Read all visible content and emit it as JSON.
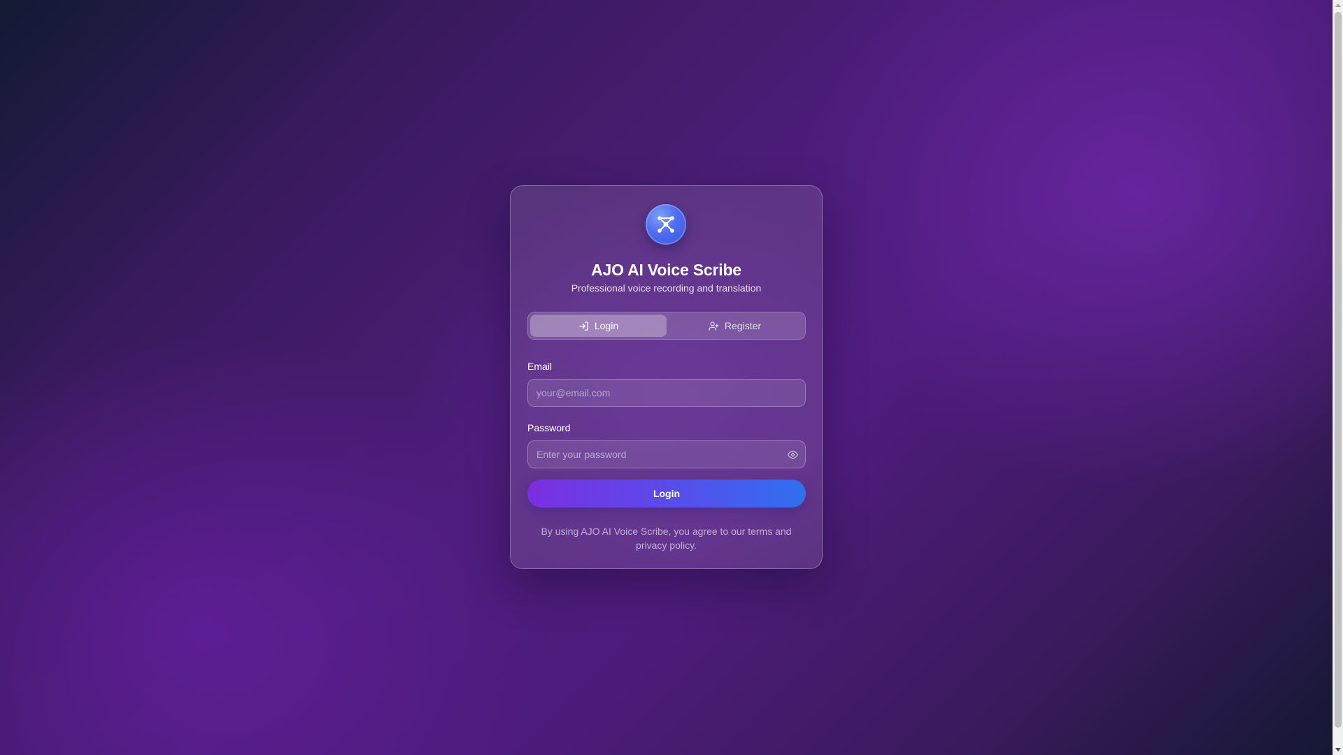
{
  "app": {
    "title": "AJO AI Voice Scribe",
    "subtitle": "Professional voice recording and translation",
    "logo_icon": "network-nodes-icon"
  },
  "tabs": [
    {
      "label": "Login",
      "icon": "log-in-icon",
      "active": true
    },
    {
      "label": "Register",
      "icon": "user-plus-icon",
      "active": false
    }
  ],
  "form": {
    "email_label": "Email",
    "email_placeholder": "your@email.com",
    "email_value": "",
    "password_label": "Password",
    "password_placeholder": "Enter your password",
    "password_value": "",
    "password_toggle_icon": "eye-icon",
    "submit_label": "Login"
  },
  "footer": {
    "terms": "By using AJO AI Voice Scribe, you agree to our terms and privacy policy."
  },
  "colors": {
    "accent_start": "#7b2fe0",
    "accent_end": "#2f6ff0",
    "background": "#4b1d78"
  }
}
